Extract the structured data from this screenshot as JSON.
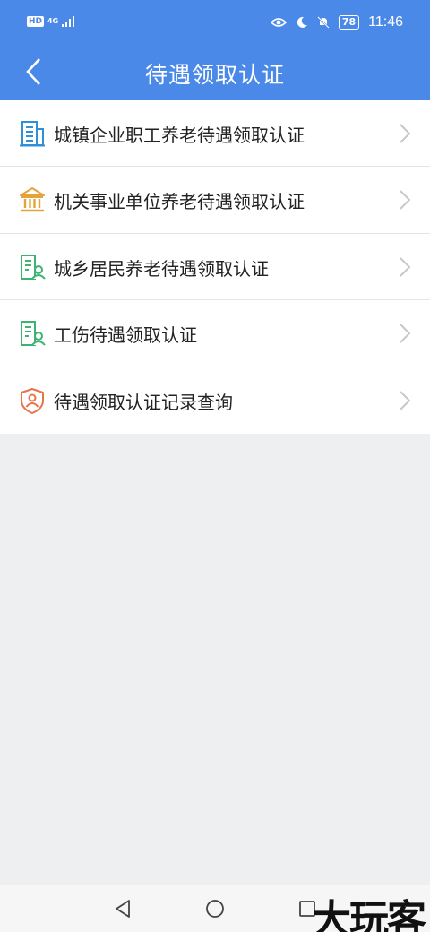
{
  "status_bar": {
    "hd": "HD",
    "network": "4G",
    "battery": "78",
    "time": "11:46"
  },
  "header": {
    "title": "待遇领取认证"
  },
  "menu": {
    "items": [
      {
        "label": "城镇企业职工养老待遇领取认证",
        "icon": "office-building-icon",
        "color": "#2f8fd8"
      },
      {
        "label": "机关事业单位养老待遇领取认证",
        "icon": "institution-icon",
        "color": "#e3a53a"
      },
      {
        "label": "城乡居民养老待遇领取认证",
        "icon": "resident-building-icon",
        "color": "#3cb371"
      },
      {
        "label": "工伤待遇领取认证",
        "icon": "injury-building-icon",
        "color": "#3cb371"
      },
      {
        "label": "待遇领取认证记录查询",
        "icon": "record-shield-icon",
        "color": "#e8744a"
      }
    ]
  },
  "watermark": {
    "text": "大玩客"
  },
  "colors": {
    "header_bg": "#4a89e8",
    "page_bg": "#eeeff1"
  }
}
